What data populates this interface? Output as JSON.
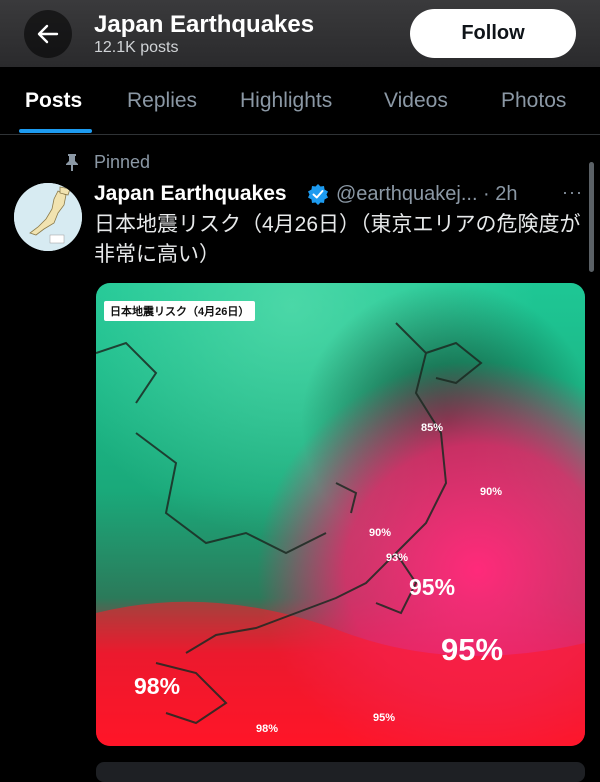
{
  "header": {
    "title": "Japan Earthquakes",
    "post_count": "12.1K posts",
    "follow_label": "Follow"
  },
  "tabs": [
    "Posts",
    "Replies",
    "Highlights",
    "Videos",
    "Photos"
  ],
  "active_tab": "Posts",
  "post": {
    "pinned_label": "Pinned",
    "author": "Japan Earthquakes",
    "handle_time": "@earthquakej... · 2h",
    "more": "···",
    "text": "日本地震リスク（4月26日）（東京エリアの危険度が非常に高い）",
    "image": {
      "label": "日本地震リスク（4月26日）",
      "percentages": [
        "85%",
        "90%",
        "90%",
        "93%",
        "95%",
        "95%",
        "98%",
        "98%",
        "95%"
      ]
    }
  },
  "colors": {
    "accent": "#1d9bf0",
    "background": "#000000",
    "risk_high": "#ff1a2a",
    "risk_low": "#1fb88a"
  }
}
